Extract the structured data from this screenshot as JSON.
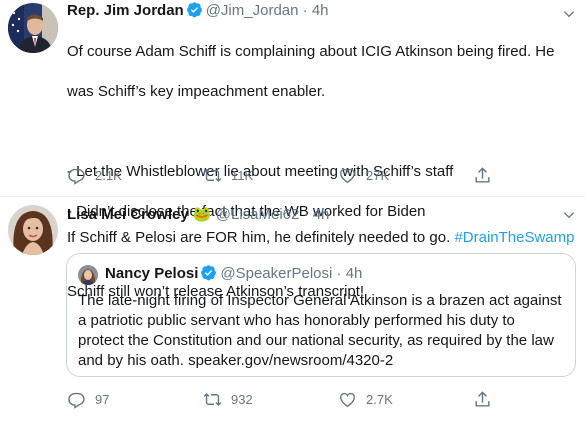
{
  "tweets": [
    {
      "name": "Rep. Jim Jordan",
      "handle": "@Jim_Jordan",
      "separator": "·",
      "time": "4h",
      "verified": true,
      "text_lines": [
        "Of course Adam Schiff is complaining about ICIG Atkinson being fired. He",
        "was Schiff’s key impeachment enabler.",
        "",
        "- Let the Whistleblower lie about meeting with Schiff’s staff",
        "- Didn’t disclose the fact that the WB worked for Biden",
        "",
        "Schiff still won’t release Atkinson’s transcript!"
      ],
      "reply_count": "2.1K",
      "retweet_count": "11K",
      "like_count": "27K",
      "icons": [
        "reply-icon",
        "retweet-icon",
        "like-icon",
        "share-icon"
      ]
    },
    {
      "name": "Lisa Mei Crowley",
      "emoji": "🐸",
      "handle": "@LisaMei62",
      "separator": "·",
      "time": "4h",
      "text": "If Schiff & Pelosi are FOR him, he definitely needed to go.",
      "hashtag": "#DrainTheSwamp",
      "quote": {
        "name": "Nancy Pelosi",
        "handle": "@SpeakerPelosi",
        "separator": "·",
        "time": "4h",
        "verified": true,
        "text_lines": [
          "The late-night firing of Inspector General Atkinson is a brazen act against",
          "a patriotic public servant who has honorably performed his duty to",
          "protect the Constitution and our national security, as required by the law",
          "and by his oath. speaker.gov/newsroom/4320-2"
        ]
      },
      "reply_count": "97",
      "retweet_count": "932",
      "like_count": "2.7K"
    }
  ],
  "colors": {
    "accent": "#1da1f2",
    "text": "#14171a",
    "muted": "#657786",
    "border": "#ccd6dd"
  }
}
